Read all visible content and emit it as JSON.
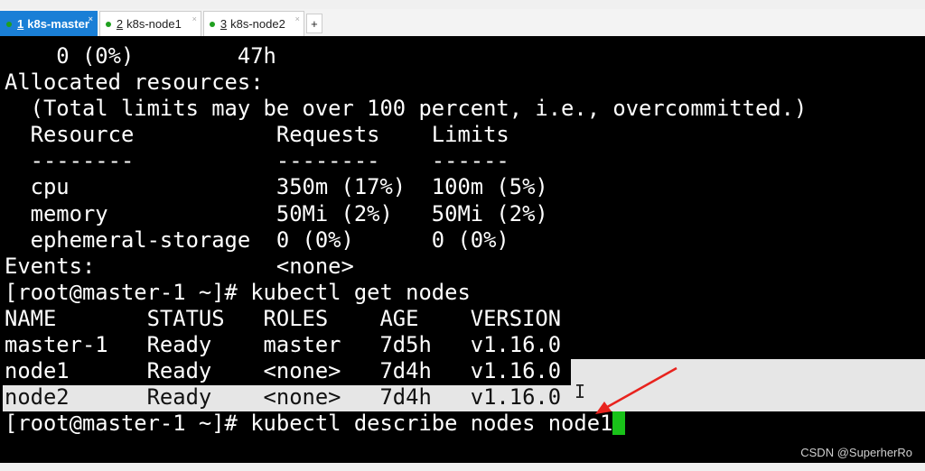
{
  "tabs": [
    {
      "num": "1",
      "label": "k8s-master",
      "active": true
    },
    {
      "num": "2",
      "label": "k8s-node1",
      "active": false
    },
    {
      "num": "3",
      "label": "k8s-node2",
      "active": false
    }
  ],
  "add_tab": "+",
  "close_glyph": "×",
  "terminal": {
    "lines": [
      "    0 (0%)        47h",
      "Allocated resources:",
      "  (Total limits may be over 100 percent, i.e., overcommitted.)",
      "  Resource           Requests    Limits",
      "  --------           --------    ------",
      "  cpu                350m (17%)  100m (5%)",
      "  memory             50Mi (2%)   50Mi (2%)",
      "  ephemeral-storage  0 (0%)      0 (0%)",
      "Events:              <none>",
      "[root@master-1 ~]# kubectl get nodes",
      "NAME       STATUS   ROLES    AGE    VERSION",
      "master-1   Ready    master   7d5h   v1.16.0",
      "node1      Ready    <none>   7d4h   v1.16.0",
      "node2      Ready    <none>   7d4h   v1.16.0",
      "[root@master-1 ~]# kubectl describe nodes node1"
    ],
    "cursor_color": "#19c219",
    "selection_color": "#e6e6e6"
  },
  "annotation_arrow_color": "#e8231e",
  "watermark": "CSDN @SuperherRo"
}
